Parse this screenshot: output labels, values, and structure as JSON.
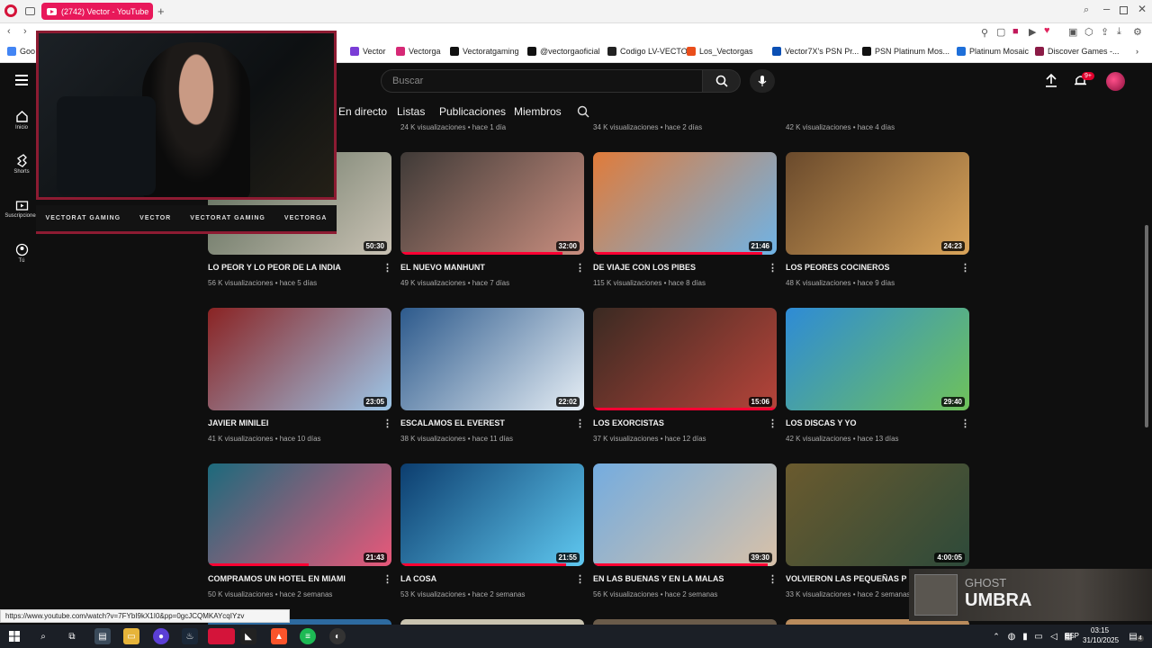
{
  "browser": {
    "tab_title": "(2742) Vector - YouTube",
    "bookmarks": [
      "Vector",
      "Vectorga",
      "Vectoratgaming",
      "@vectorgaoficial",
      "Codigo LV-VECTOR",
      "Los_Vectorgas",
      "Vector7X's PSN Pr...",
      "PSN Platinum Mos...",
      "Platinum Mosaic",
      "Discover Games -..."
    ],
    "bookmark_colors": [
      "#7a3dd6",
      "#d62976",
      "#111111",
      "#111111",
      "#222222",
      "#e94e1b",
      "#0a4fb4",
      "#111111",
      "#1e6fd9",
      "#8b1b46"
    ],
    "status_url": "https://www.youtube.com/watch?v=7FYbI9kX1I0&pp=0gcJCQMKAYcqIYzv"
  },
  "youtube": {
    "search_placeholder": "Buscar",
    "notif_badge": "9+",
    "channel_tabs": [
      "En directo",
      "Listas",
      "Publicaciones",
      "Miembros"
    ],
    "sidebar": [
      {
        "label": "Inicio",
        "icon": "home-icon"
      },
      {
        "label": "Shorts",
        "icon": "shorts-icon"
      },
      {
        "label": "Suscripciones",
        "icon": "subscriptions-icon"
      },
      {
        "label": "Tú",
        "icon": "you-icon"
      }
    ],
    "top_partial_meta": [
      "24 K visualizaciones • hace 1 día",
      "34 K visualizaciones • hace 2 días",
      "42 K visualizaciones • hace 4 días"
    ],
    "videos": [
      {
        "title": "LO PEOR Y LO PEOR DE LA INDIA",
        "meta": "56 K visualizaciones • hace 5 días",
        "duration": "50:30",
        "progress": 0.0,
        "colors": [
          "#5b6a58",
          "#c9c2b4"
        ]
      },
      {
        "title": "EL NUEVO MANHUNT",
        "meta": "49 K visualizaciones • hace 7 días",
        "duration": "32:00",
        "progress": 0.88,
        "colors": [
          "#3f3a37",
          "#c98e7f"
        ]
      },
      {
        "title": "DE VIAJE CON LOS PIBES",
        "meta": "115 K visualizaciones • hace 8 días",
        "duration": "21:46",
        "progress": 0.92,
        "colors": [
          "#e07b3a",
          "#6fb3e6"
        ]
      },
      {
        "title": "LOS PEORES COCINEROS",
        "meta": "48 K visualizaciones • hace 9 días",
        "duration": "24:23",
        "progress": 0.0,
        "colors": [
          "#6a4a2c",
          "#d9a45a"
        ]
      },
      {
        "title": "JAVIER MINILEI",
        "meta": "41 K visualizaciones • hace 10 días",
        "duration": "23:05",
        "progress": 0.0,
        "colors": [
          "#8a2323",
          "#9dc6e8"
        ]
      },
      {
        "title": "ESCALAMOS EL EVEREST",
        "meta": "38 K visualizaciones • hace 11 días",
        "duration": "22:02",
        "progress": 0.0,
        "colors": [
          "#2d5a8c",
          "#e6eef5"
        ]
      },
      {
        "title": "LOS EXORCISTAS",
        "meta": "37 K visualizaciones • hace 12 días",
        "duration": "15:06",
        "progress": 0.99,
        "colors": [
          "#3a2a22",
          "#b6443a"
        ]
      },
      {
        "title": "LOS DISCAS Y YO",
        "meta": "42 K visualizaciones • hace 13 días",
        "duration": "29:40",
        "progress": 0.0,
        "colors": [
          "#2e8bd6",
          "#6fc25a"
        ]
      },
      {
        "title": "COMPRAMOS UN HOTEL EN MIAMI",
        "meta": "50 K visualizaciones • hace 2 semanas",
        "duration": "21:43",
        "progress": 0.55,
        "colors": [
          "#1c6a7c",
          "#e8587a"
        ]
      },
      {
        "title": "LA COSA",
        "meta": "53 K visualizaciones • hace 2 semanas",
        "duration": "21:55",
        "progress": 0.9,
        "colors": [
          "#0c3d6e",
          "#5fc8f0"
        ]
      },
      {
        "title": "EN LAS BUENAS Y EN LA MALAS",
        "meta": "56 K visualizaciones • hace 2 semanas",
        "duration": "39:30",
        "progress": 0.95,
        "colors": [
          "#74acdf",
          "#d8c1a8"
        ]
      },
      {
        "title": "VOLVIERON LAS PEQUEÑAS PESADILLAS",
        "meta": "33 K visualizaciones • hace 2 semanas",
        "duration": "4:00:05",
        "progress": 0.0,
        "colors": [
          "#6a5a2e",
          "#2d4a3a"
        ]
      }
    ]
  },
  "overlay": {
    "social_strip": [
      "VECTORAT GAMING",
      "VECTOR",
      "VECTORAT GAMING",
      "VECTORGA"
    ],
    "ghost_small": "GHOST",
    "ghost_big": "UMBRA"
  },
  "taskbar": {
    "lang": "ESP",
    "time": "03:15",
    "date": "31/10/2025",
    "notif_count": "4"
  }
}
